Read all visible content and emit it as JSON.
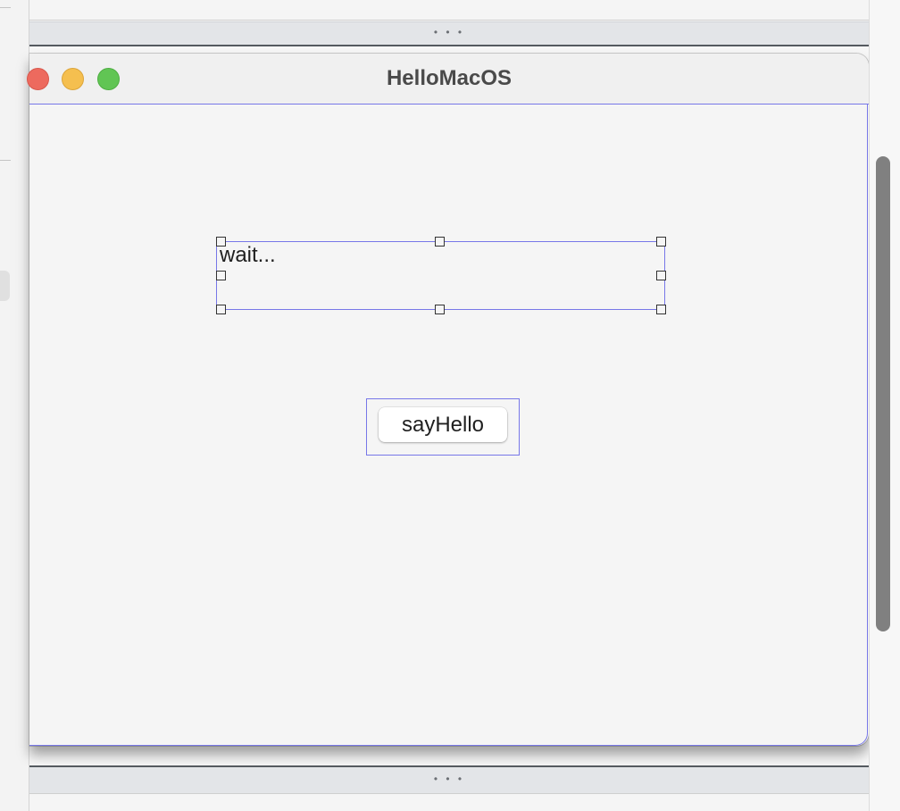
{
  "window": {
    "title": "HelloMacOS"
  },
  "label": {
    "text": "wait..."
  },
  "button": {
    "label": "sayHello"
  },
  "divider": {
    "grip": "• • •"
  },
  "colors": {
    "selection": "#7777e8",
    "close": "#ed6a5e",
    "minimize": "#f5bf4f",
    "zoom": "#61c554"
  }
}
